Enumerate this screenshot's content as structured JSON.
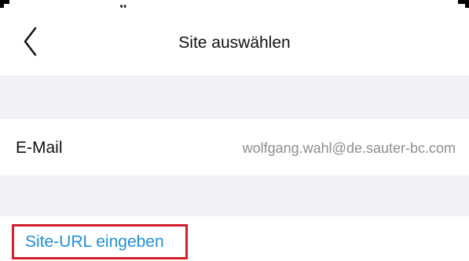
{
  "top_partial_text": "„",
  "header": {
    "back_icon": "chevron-left-icon",
    "title": "Site auswählen"
  },
  "account": {
    "label": "E-Mail",
    "value": "wolfgang.wahl@de.sauter-bc.com"
  },
  "action": {
    "label": "Site-URL eingeben"
  },
  "colors": {
    "background": "#ffffff",
    "section_background": "#f2f2f6",
    "primary_text": "#111111",
    "secondary_text": "#8e8e93",
    "link": "#1f8fd5",
    "highlight_border": "#d21f2b"
  }
}
